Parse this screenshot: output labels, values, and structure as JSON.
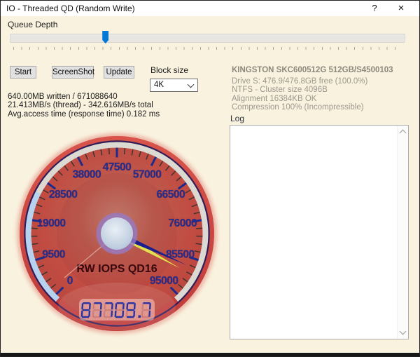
{
  "window": {
    "title": "IO - Threaded QD (Random Write)",
    "help": "?",
    "close": "×"
  },
  "queue_depth": {
    "label": "Queue Depth",
    "thumb_pct": 24.2
  },
  "toolbar": {
    "start": "Start",
    "screenshot": "ScreenShot",
    "update": "Update"
  },
  "block_size": {
    "label": "Block size",
    "value": "4K"
  },
  "stats": {
    "lines": [
      "640.00MB written / 671088640",
      "21.413MB/s (thread) - 342.616MB/s total",
      "Avg.access time (response time) 0.182 ms"
    ]
  },
  "drive_info": {
    "title": "KINGSTON SKC600512G 512GB/S4500103",
    "lines": [
      "Drive S: 476.9/476.8GB free (100.0%)",
      "NTFS - Cluster size 4096B",
      "Alignment 16384KB OK",
      "Compression 100% (Incompressible)"
    ]
  },
  "log": {
    "label": "Log"
  },
  "chart_data": {
    "type": "gauge",
    "title": "RW IOPS QD16",
    "min": 0,
    "max": 95000,
    "major_ticks": [
      0,
      9500,
      19000,
      28500,
      38000,
      47500,
      57000,
      66500,
      76000,
      85500,
      95000
    ],
    "minor_step": 1900,
    "value": 87709.7,
    "display": "87709.7",
    "needle2_value": 89300,
    "start_angle_deg": 135,
    "sweep_deg": 270,
    "band_color": "#dcd9d2",
    "band_highlight": {
      "from": 0,
      "to": 25500,
      "color": "#b7d2ee"
    },
    "label_color": "#232e8f",
    "tick_major_color": "#1f2b8a",
    "tick_minor_color": "#3f332f",
    "needle_color": "#1a1e8e",
    "needle2_color": "#e4df4e",
    "title_color": "#38070d",
    "digit_color": "#2a33a3"
  }
}
